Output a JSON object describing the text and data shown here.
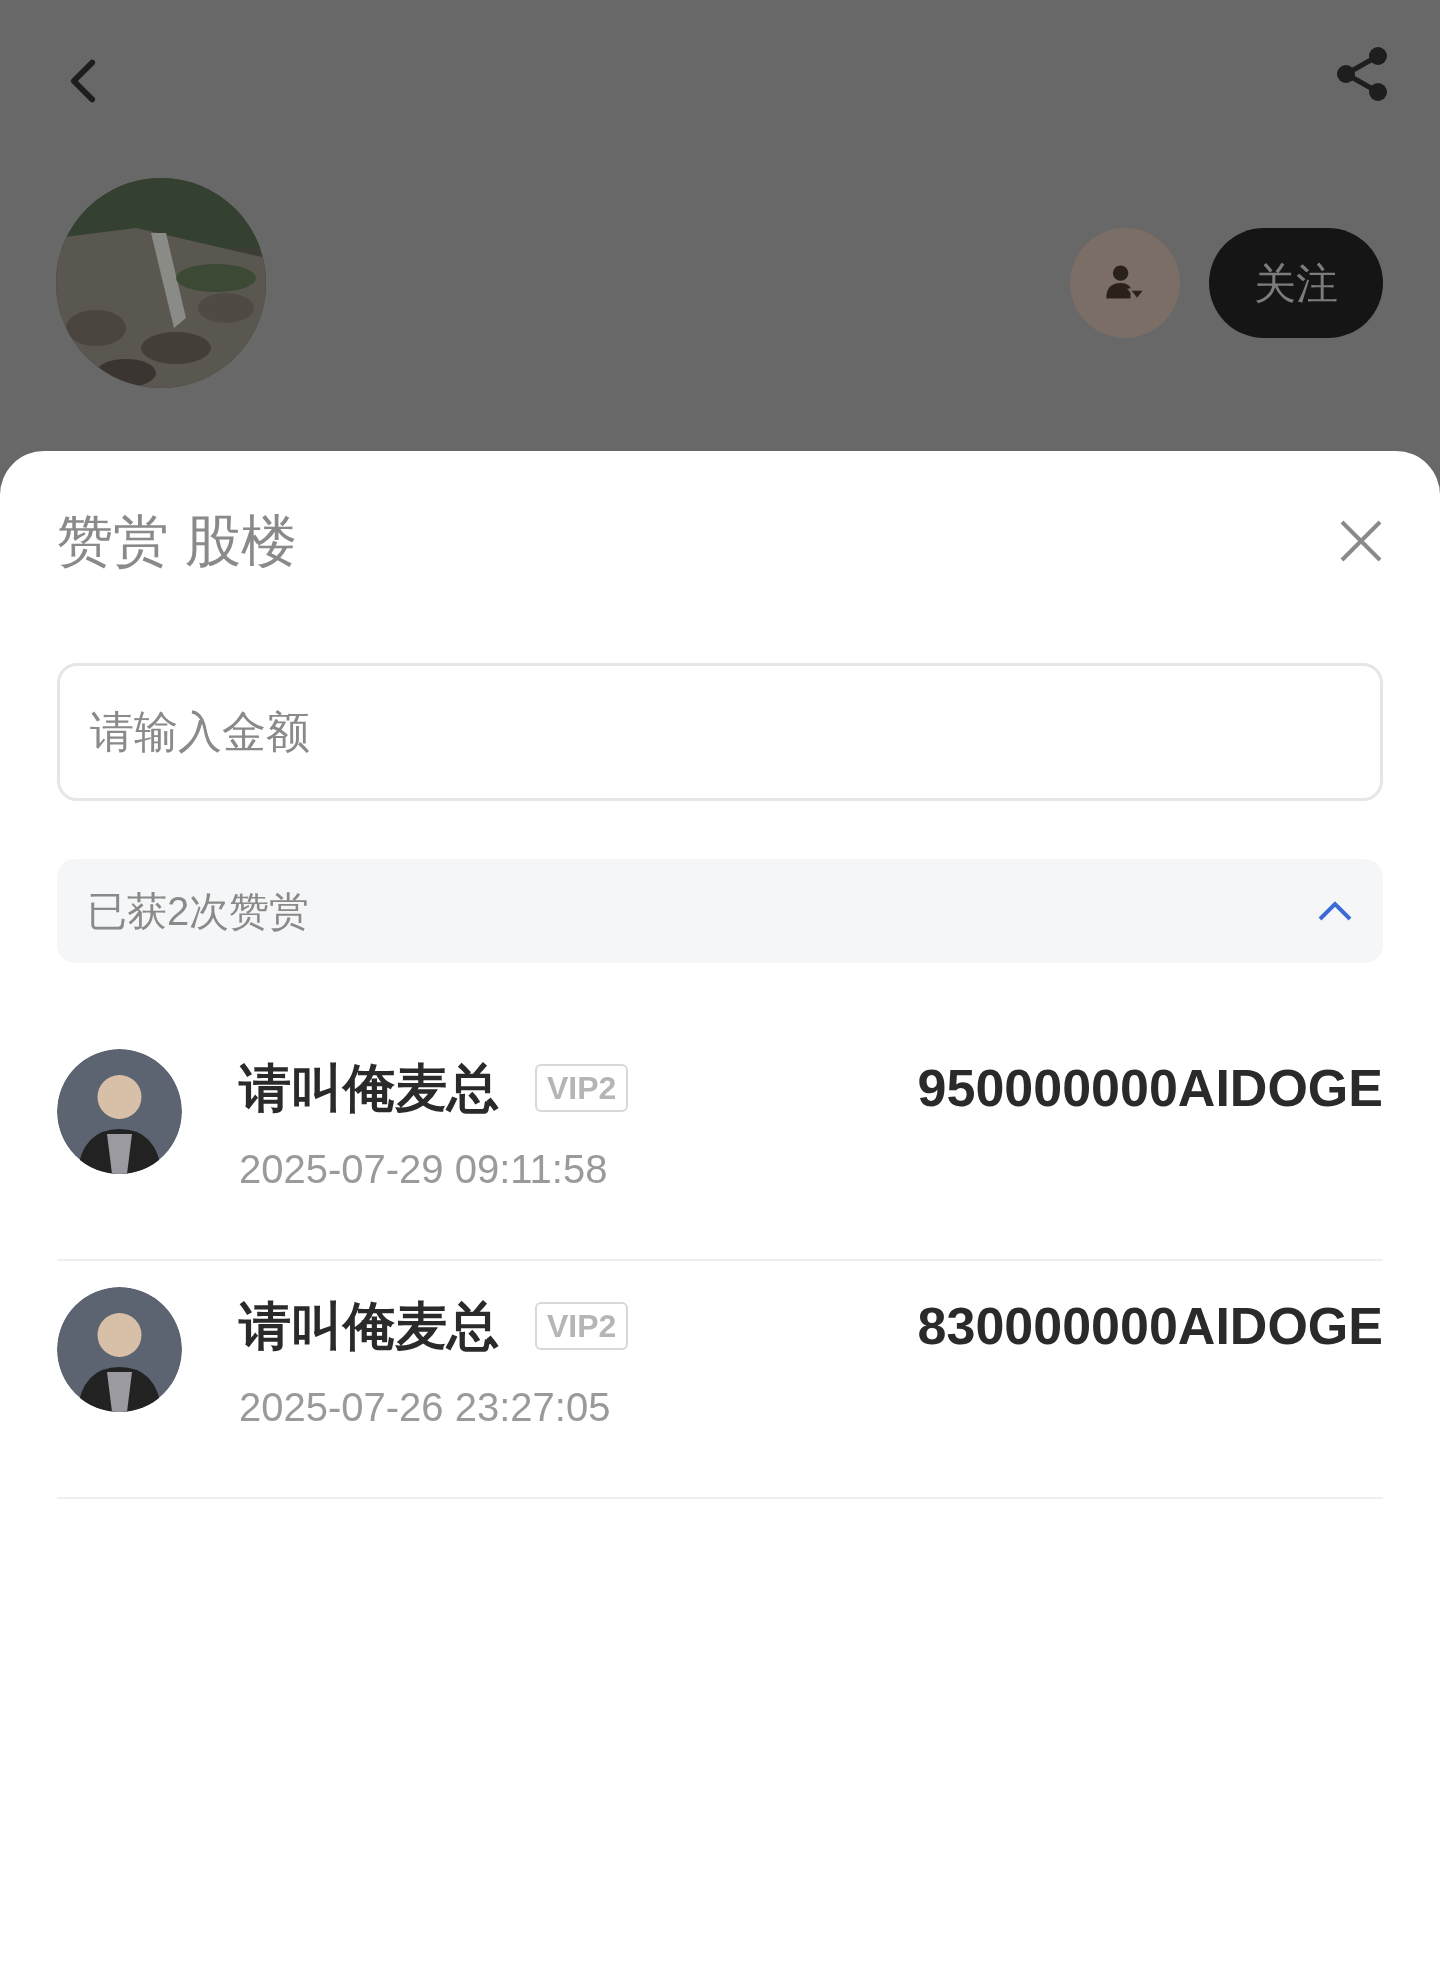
{
  "profile": {
    "follow_button": "关注"
  },
  "sheet": {
    "title": "赞赏 股楼",
    "amount_field": {
      "placeholder": "请输入金额"
    },
    "summary": {
      "label": "已获2次赞赏",
      "expanded": true
    },
    "rewards": [
      {
        "name": "请叫俺麦总",
        "badge": "VIP2",
        "time": "2025-07-29 09:11:58",
        "amount": "950000000AIDOGE"
      },
      {
        "name": "请叫俺麦总",
        "badge": "VIP2",
        "time": "2025-07-26 23:27:05",
        "amount": "830000000AIDOGE"
      }
    ]
  }
}
